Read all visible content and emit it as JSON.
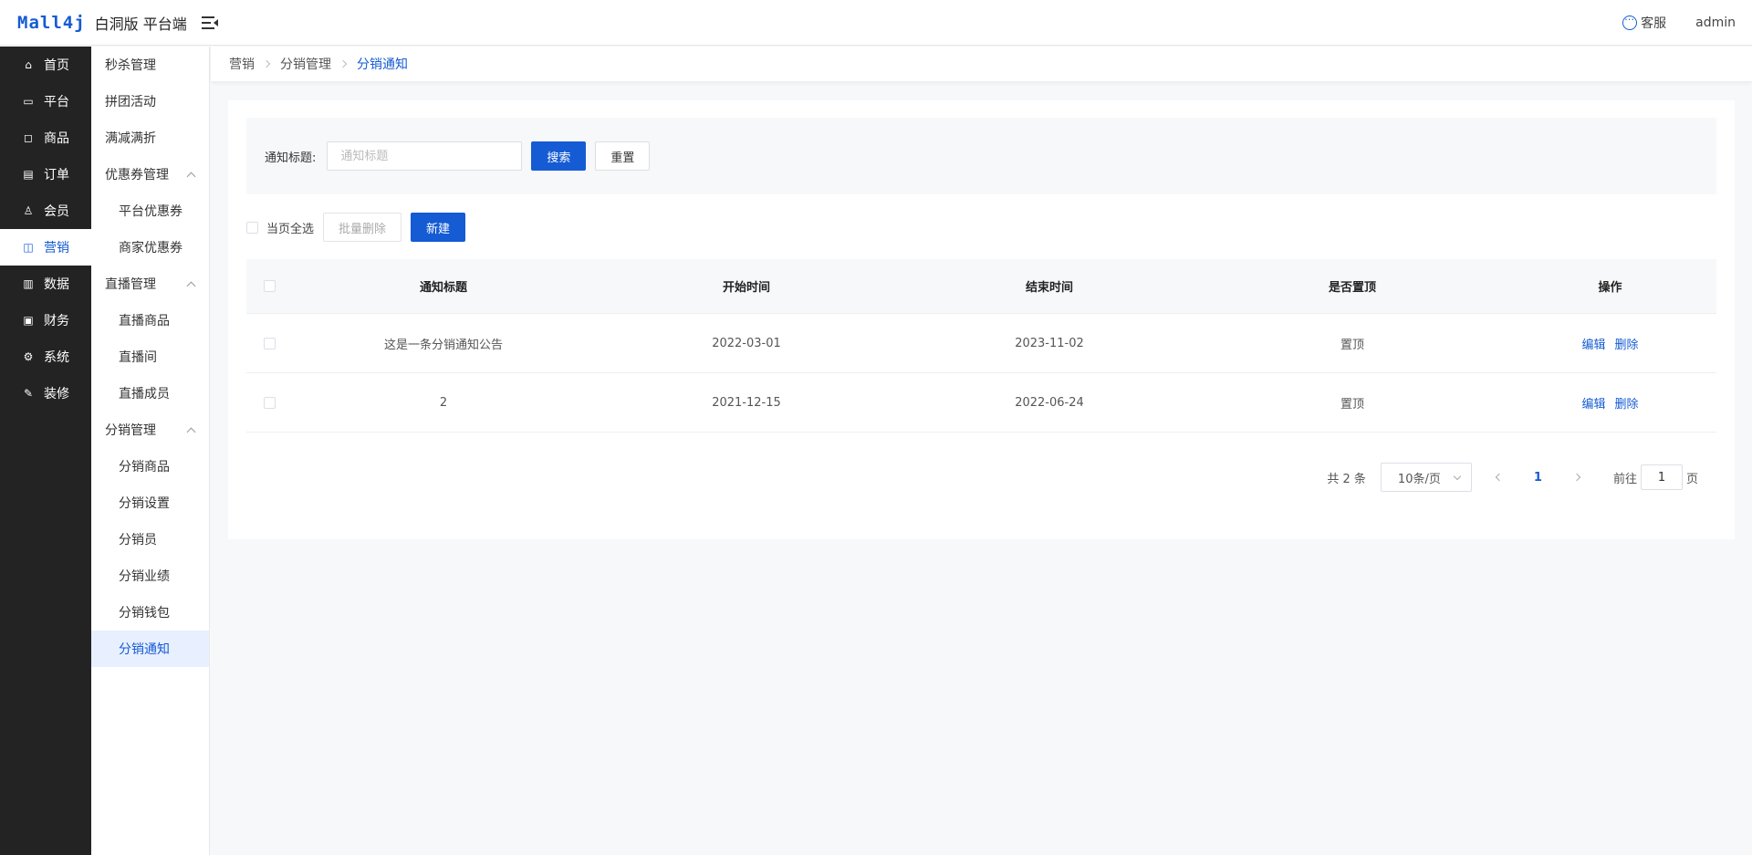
{
  "header": {
    "logo": "Mall4j",
    "title": "白洞版 平台端",
    "service_label": "客服",
    "user": "admin"
  },
  "sidebar": {
    "items": [
      {
        "label": "首页",
        "icon": "home-icon",
        "glyph": "⌂"
      },
      {
        "label": "平台",
        "icon": "monitor-icon",
        "glyph": "▭"
      },
      {
        "label": "商品",
        "icon": "bag-icon",
        "glyph": "◻"
      },
      {
        "label": "订单",
        "icon": "document-icon",
        "glyph": "▤"
      },
      {
        "label": "会员",
        "icon": "users-icon",
        "glyph": "♙"
      },
      {
        "label": "营销",
        "icon": "gift-icon",
        "glyph": "◫"
      },
      {
        "label": "数据",
        "icon": "chart-icon",
        "glyph": "▥"
      },
      {
        "label": "财务",
        "icon": "finance-icon",
        "glyph": "▣"
      },
      {
        "label": "系统",
        "icon": "settings-icon",
        "glyph": "⚙"
      },
      {
        "label": "装修",
        "icon": "decorate-icon",
        "glyph": "✎"
      }
    ],
    "active_index": 5
  },
  "submenu": {
    "items": [
      {
        "label": "秒杀管理",
        "type": "item"
      },
      {
        "label": "拼团活动",
        "type": "item"
      },
      {
        "label": "满减满折",
        "type": "item"
      },
      {
        "label": "优惠券管理",
        "type": "group"
      },
      {
        "label": "平台优惠券",
        "type": "sub"
      },
      {
        "label": "商家优惠券",
        "type": "sub"
      },
      {
        "label": "直播管理",
        "type": "group"
      },
      {
        "label": "直播商品",
        "type": "sub"
      },
      {
        "label": "直播间",
        "type": "sub"
      },
      {
        "label": "直播成员",
        "type": "sub"
      },
      {
        "label": "分销管理",
        "type": "group"
      },
      {
        "label": "分销商品",
        "type": "sub"
      },
      {
        "label": "分销设置",
        "type": "sub"
      },
      {
        "label": "分销员",
        "type": "sub"
      },
      {
        "label": "分销业绩",
        "type": "sub"
      },
      {
        "label": "分销钱包",
        "type": "sub"
      },
      {
        "label": "分销通知",
        "type": "sub",
        "active": true
      }
    ]
  },
  "breadcrumb": [
    "营销",
    "分销管理",
    "分销通知"
  ],
  "filter": {
    "label": "通知标题:",
    "input_value": "",
    "input_placeholder": "通知标题",
    "search_label": "搜索",
    "reset_label": "重置"
  },
  "toolbar": {
    "select_all_label": "当页全选",
    "batch_delete_label": "批量删除",
    "new_label": "新建"
  },
  "table": {
    "columns": [
      "通知标题",
      "开始时间",
      "结束时间",
      "是否置顶",
      "操作"
    ],
    "rows": [
      {
        "title": "这是一条分销通知公告",
        "start": "2022-03-01",
        "end": "2023-11-02",
        "pinned": "置顶"
      },
      {
        "title": "2",
        "start": "2021-12-15",
        "end": "2022-06-24",
        "pinned": "置顶"
      }
    ],
    "edit_label": "编辑",
    "delete_label": "删除"
  },
  "pagination": {
    "total_text": "共 2 条",
    "page_size": "10条/页",
    "current_page": "1",
    "goto_prefix": "前往",
    "goto_value": "1",
    "goto_suffix": "页"
  },
  "colors": {
    "primary": "#155bd4",
    "sidebar_bg": "#232323",
    "page_bg": "#f7f8fa"
  }
}
